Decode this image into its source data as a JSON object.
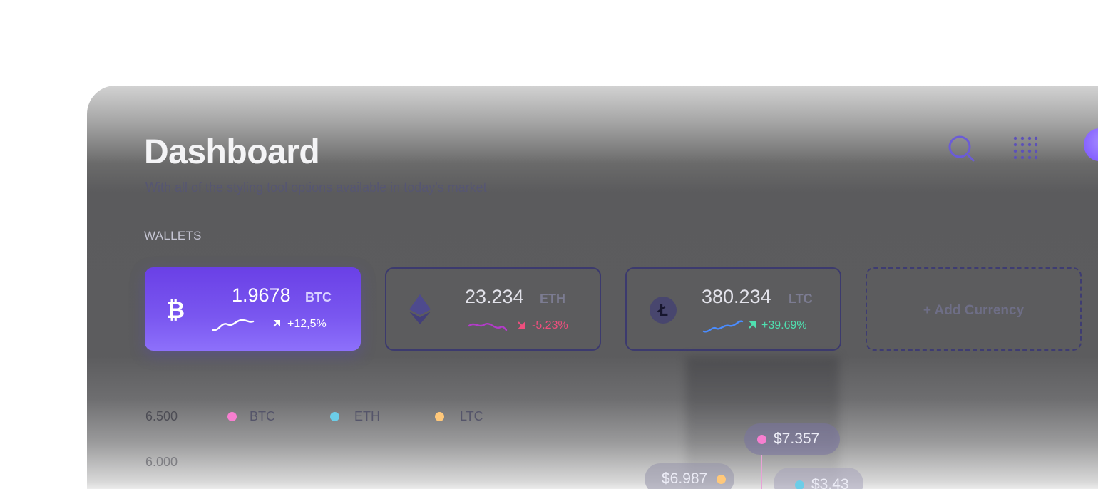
{
  "header": {
    "title": "Dashboard",
    "subtitle": "With all of the styling tool options available in today's market",
    "search_icon": "search-icon",
    "grid_icon": "grid-menu-icon"
  },
  "wallets": {
    "section_label": "WALLETS",
    "items": [
      {
        "amount": "1.9678",
        "unit": "BTC",
        "change": "+12,5%",
        "trend": "up",
        "icon": "bitcoin-icon",
        "active": true
      },
      {
        "amount": "23.234",
        "unit": "ETH",
        "change": "-5.23%",
        "trend": "down",
        "icon": "ethereum-icon",
        "active": false
      },
      {
        "amount": "380.234",
        "unit": "LTC",
        "change": "+39.69%",
        "trend": "up",
        "icon": "litecoin-icon",
        "active": false
      }
    ],
    "add_label": "+ Add Currency"
  },
  "chart": {
    "y_labels": [
      "6.500",
      "6.000"
    ],
    "legend": [
      {
        "name": "BTC",
        "color": "#f77fd0"
      },
      {
        "name": "ETH",
        "color": "#6ccde8"
      },
      {
        "name": "LTC",
        "color": "#ffc87a"
      }
    ],
    "tooltips": [
      {
        "value": "$7.357",
        "color": "#f77fd0"
      },
      {
        "value": "$6.987",
        "color": "#ffc87a"
      },
      {
        "value": "$3.43",
        "color": "#6ccde8"
      }
    ]
  },
  "colors": {
    "accent": "#7a52ff",
    "positive": "#4fe0b0",
    "negative": "#ee4f7e"
  }
}
